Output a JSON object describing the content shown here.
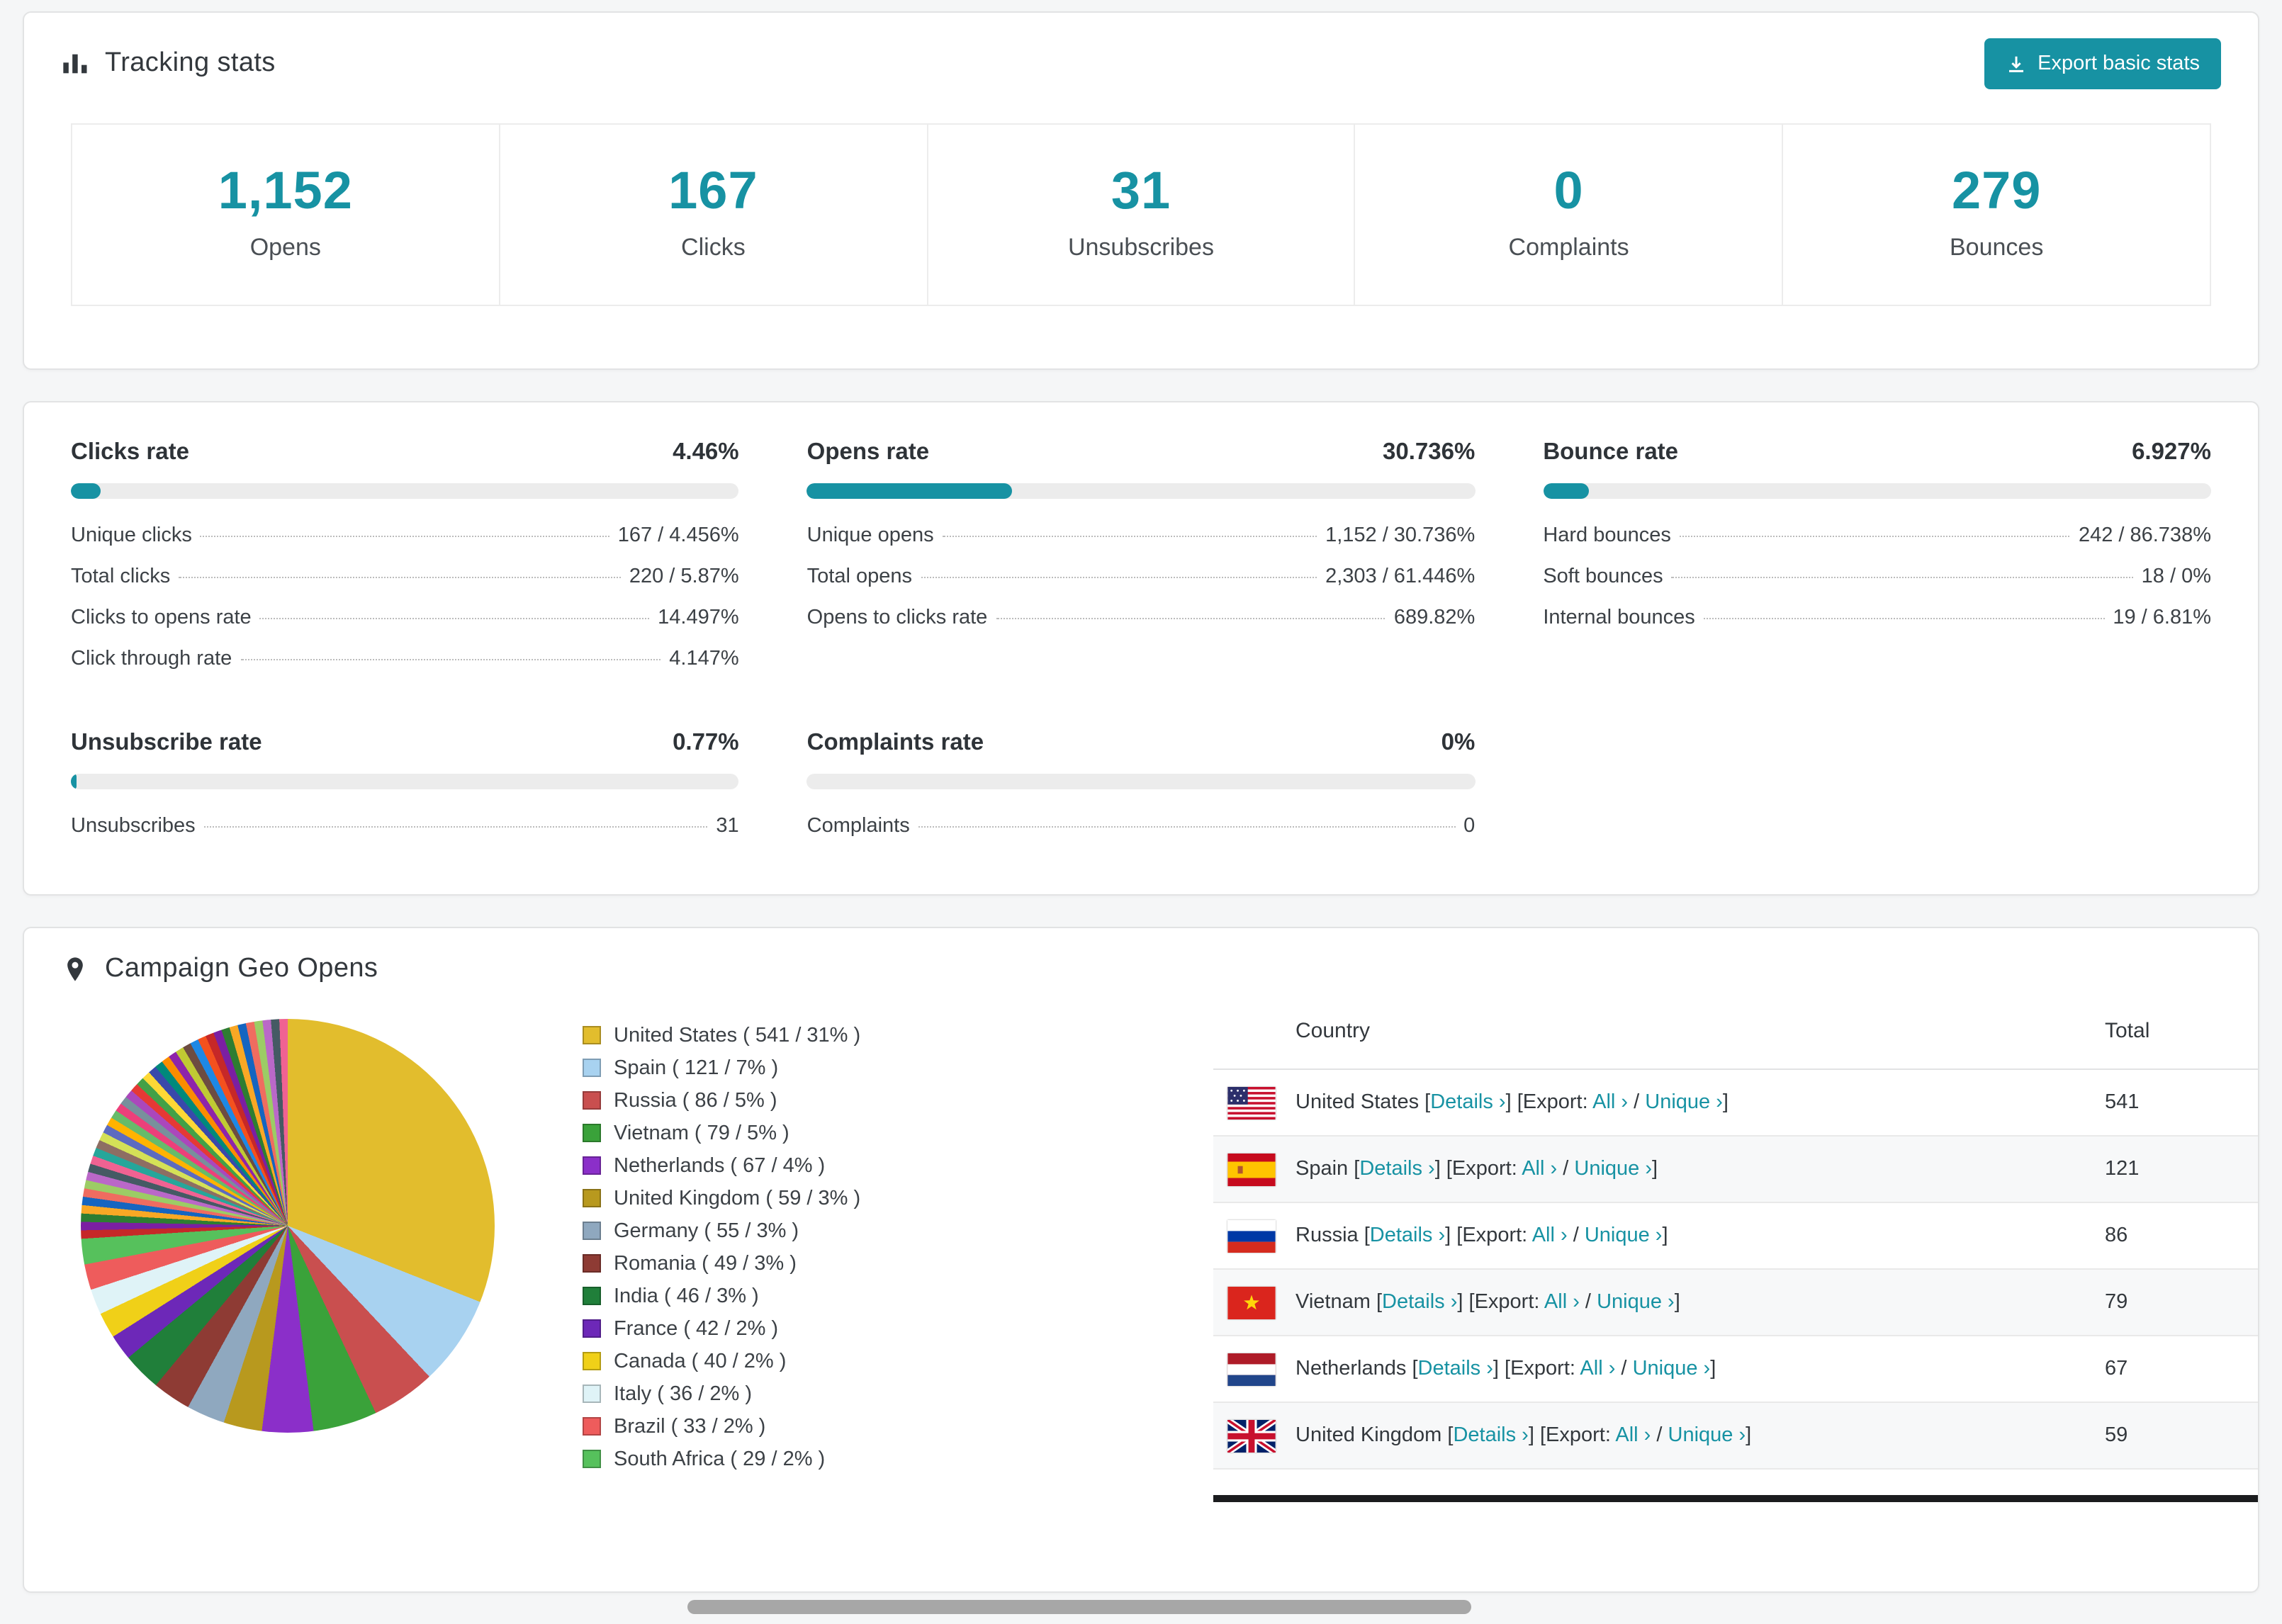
{
  "accent_color": "#1792a3",
  "tracking": {
    "title": "Tracking stats",
    "export_button_label": "Export basic stats",
    "stats": [
      {
        "value": "1,152",
        "label": "Opens"
      },
      {
        "value": "167",
        "label": "Clicks"
      },
      {
        "value": "31",
        "label": "Unsubscribes"
      },
      {
        "value": "0",
        "label": "Complaints"
      },
      {
        "value": "279",
        "label": "Bounces"
      }
    ]
  },
  "rates": [
    {
      "title": "Clicks rate",
      "value": "4.46%",
      "percent": 4.46,
      "rows": [
        {
          "label": "Unique clicks",
          "value": "167 / 4.456%"
        },
        {
          "label": "Total clicks",
          "value": "220 / 5.87%"
        },
        {
          "label": "Clicks to opens rate",
          "value": "14.497%"
        },
        {
          "label": "Click through rate",
          "value": "4.147%"
        }
      ]
    },
    {
      "title": "Opens rate",
      "value": "30.736%",
      "percent": 30.736,
      "rows": [
        {
          "label": "Unique opens",
          "value": "1,152 / 30.736%"
        },
        {
          "label": "Total opens",
          "value": "2,303 / 61.446%"
        },
        {
          "label": "Opens to clicks rate",
          "value": "689.82%"
        }
      ]
    },
    {
      "title": "Bounce rate",
      "value": "6.927%",
      "percent": 6.927,
      "rows": [
        {
          "label": "Hard bounces",
          "value": "242 / 86.738%"
        },
        {
          "label": "Soft bounces",
          "value": "18 / 0%"
        },
        {
          "label": "Internal bounces",
          "value": "19 / 6.81%"
        }
      ]
    },
    {
      "title": "Unsubscribe rate",
      "value": "0.77%",
      "percent": 0.77,
      "rows": [
        {
          "label": "Unsubscribes",
          "value": "31"
        }
      ]
    },
    {
      "title": "Complaints rate",
      "value": "0%",
      "percent": 0,
      "rows": [
        {
          "label": "Complaints",
          "value": "0"
        }
      ]
    }
  ],
  "geo": {
    "title": "Campaign Geo Opens",
    "table": {
      "headers": [
        "Country",
        "Total"
      ],
      "link_labels": {
        "details": "Details ›",
        "export_prefix": "Export:",
        "all": "All ›",
        "unique": "Unique ›"
      },
      "rows": [
        {
          "country": "United States",
          "total": "541",
          "flag": "us"
        },
        {
          "country": "Spain",
          "total": "121",
          "flag": "es"
        },
        {
          "country": "Russia",
          "total": "86",
          "flag": "ru"
        },
        {
          "country": "Vietnam",
          "total": "79",
          "flag": "vn"
        },
        {
          "country": "Netherlands",
          "total": "67",
          "flag": "nl"
        },
        {
          "country": "United Kingdom",
          "total": "59",
          "flag": "gb"
        }
      ]
    }
  },
  "chart_data": {
    "type": "pie",
    "title": "Campaign Geo Opens",
    "legend_position": "right",
    "legend_format": "{label} ( {value} / {percent}% )",
    "slices": [
      {
        "label": "United States",
        "value": 541,
        "percent": 31,
        "color": "#e2bd2d"
      },
      {
        "label": "Spain",
        "value": 121,
        "percent": 7,
        "color": "#a8d2f0"
      },
      {
        "label": "Russia",
        "value": 86,
        "percent": 5,
        "color": "#c94f4f"
      },
      {
        "label": "Vietnam",
        "value": 79,
        "percent": 5,
        "color": "#3aa23a"
      },
      {
        "label": "Netherlands",
        "value": 67,
        "percent": 4,
        "color": "#8b2fc9"
      },
      {
        "label": "United Kingdom",
        "value": 59,
        "percent": 3,
        "color": "#b8991e"
      },
      {
        "label": "Germany",
        "value": 55,
        "percent": 3,
        "color": "#8fa8bf"
      },
      {
        "label": "Romania",
        "value": 49,
        "percent": 3,
        "color": "#8e3b34"
      },
      {
        "label": "India",
        "value": 46,
        "percent": 3,
        "color": "#207f3a"
      },
      {
        "label": "France",
        "value": 42,
        "percent": 2,
        "color": "#6d28b8"
      },
      {
        "label": "Canada",
        "value": 40,
        "percent": 2,
        "color": "#f0d018"
      },
      {
        "label": "Italy",
        "value": 36,
        "percent": 2,
        "color": "#dff3f7"
      },
      {
        "label": "Brazil",
        "value": 33,
        "percent": 2,
        "color": "#ee5c5c"
      },
      {
        "label": "South Africa",
        "value": 29,
        "percent": 2,
        "color": "#56c15c"
      }
    ],
    "others_percent": 26,
    "others_slice_count": 40,
    "others_palette": [
      "#c62828",
      "#7b1fa2",
      "#2e7d32",
      "#f9a825",
      "#1565c0",
      "#ef6c60",
      "#9ccc65",
      "#ba68c8",
      "#455a64",
      "#f06292",
      "#26a69a",
      "#8d6e63",
      "#d4e157",
      "#5c6bc0",
      "#ffb300",
      "#66bb6a",
      "#ec407a",
      "#78909c",
      "#ab47bc",
      "#e53935",
      "#43a047",
      "#fdd835",
      "#3949ab",
      "#00897b",
      "#fb8c00",
      "#8e24aa",
      "#c0ca33",
      "#6d4c41",
      "#1e88e5",
      "#f4511e"
    ]
  }
}
